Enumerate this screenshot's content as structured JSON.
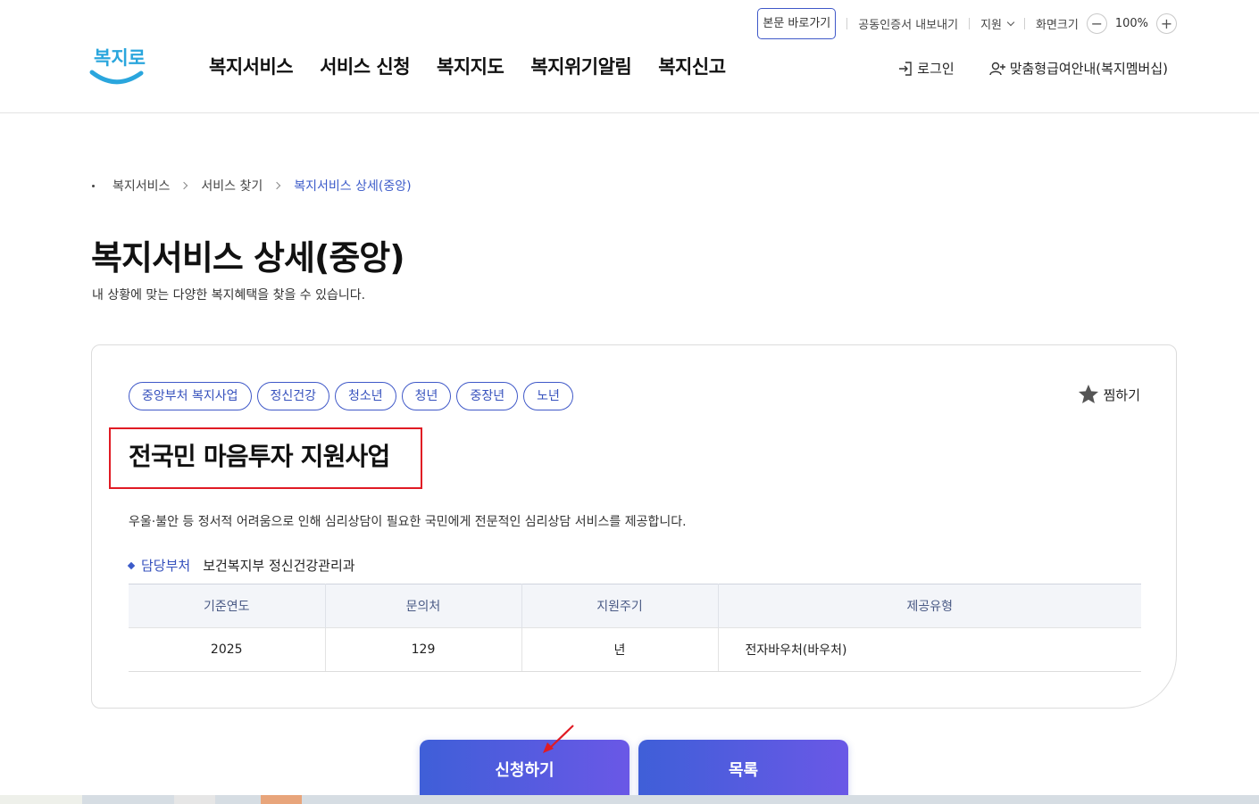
{
  "header": {
    "util": {
      "skip_link": "본문 바로가기",
      "cert_export": "공동인증서 내보내기",
      "language": "지원",
      "screen_size_label": "화면크기",
      "zoom_minus": "−",
      "zoom_value": "100%",
      "zoom_plus": "+"
    },
    "logo_text": "복지로",
    "nav": [
      "복지서비스",
      "서비스 신청",
      "복지지도",
      "복지위기알림",
      "복지신고"
    ],
    "login": "로그인",
    "membership": "맞춤형급여안내(복지멤버십)"
  },
  "breadcrumb": [
    "복지서비스",
    "서비스 찾기",
    "복지서비스 상세(중앙)"
  ],
  "page": {
    "title": "복지서비스 상세(중앙)",
    "description": "내 상황에 맞는 다양한 복지혜택을 찾을 수 있습니다."
  },
  "service": {
    "tags": [
      "중앙부처 복지사업",
      "정신건강",
      "청소년",
      "청년",
      "중장년",
      "노년"
    ],
    "favorite": "찜하기",
    "title": "전국민 마음투자 지원사업",
    "description": "우울·불안 등 정서적 어려움으로 인해 심리상담이 필요한 국민에게 전문적인 심리상담 서비스를 제공합니다.",
    "dept_label": "담당부처",
    "dept_value": "보건복지부 정신건강관리과",
    "table": {
      "headers": [
        "기준연도",
        "문의처",
        "지원주기",
        "제공유형"
      ],
      "row": [
        "2025",
        "129",
        "년",
        "전자바우처(바우처)"
      ]
    }
  },
  "buttons": {
    "apply": "신청하기",
    "list": "목록"
  },
  "colors": {
    "accent": "#3c5bc9",
    "highlight_box": "#e01b24",
    "button_gradient_start": "#3f5fd8",
    "button_gradient_end": "#6a58e6"
  }
}
